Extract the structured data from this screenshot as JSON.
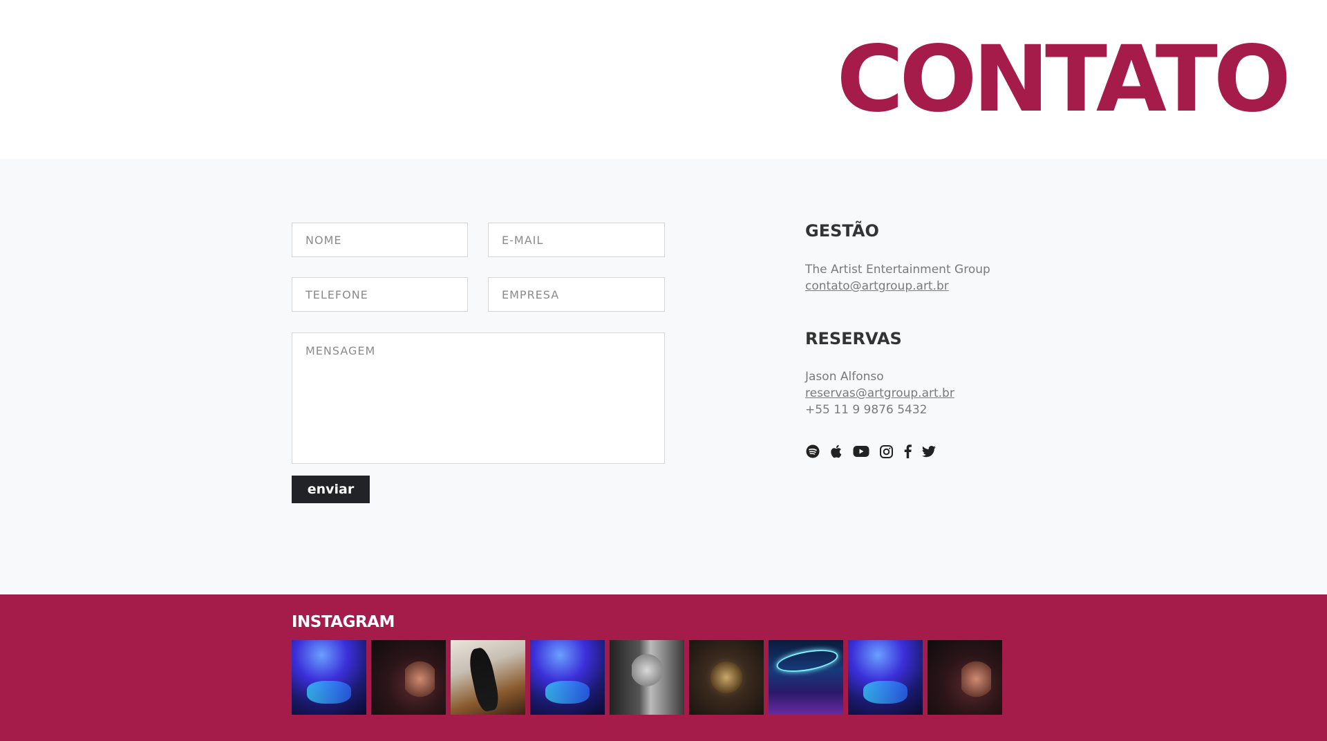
{
  "header": {
    "title": "CONTATO"
  },
  "form": {
    "nome_placeholder": "NOME",
    "email_placeholder": "E-MAIL",
    "telefone_placeholder": "TELEFONE",
    "empresa_placeholder": "EMPRESA",
    "mensagem_placeholder": "MENSAGEM",
    "submit_label": "enviar"
  },
  "gestao": {
    "heading": "GESTÃO",
    "company": "The Artist Entertainment Group",
    "email": "contato@artgroup.art.br"
  },
  "reservas": {
    "heading": "RESERVAS",
    "name": "Jason Alfonso",
    "email": "reservas@artgroup.art.br",
    "phone": "+55 11 9 9876 5432"
  },
  "socials": [
    "spotify-icon",
    "apple-icon",
    "youtube-icon",
    "instagram-icon",
    "facebook-icon",
    "twitter-icon"
  ],
  "instagram": {
    "heading": "INSTAGRAM",
    "photos": [
      "concert-stage",
      "bass-guitar-closeup",
      "black-electric-guitar",
      "concert-stage",
      "woman-portrait-bw",
      "vinyl-record",
      "neon-sign",
      "concert-stage",
      "bass-guitar-closeup"
    ]
  },
  "colors": {
    "brand": "#a51c4b",
    "button": "#222326",
    "section_bg": "#f8f9fa"
  }
}
